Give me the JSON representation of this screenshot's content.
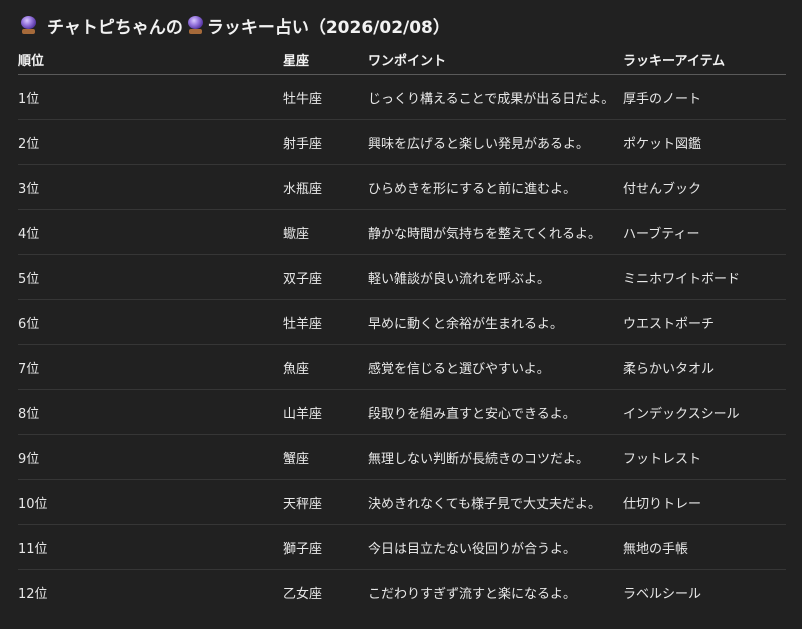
{
  "page": {
    "title": "チャトピちゃんの ラッキー占い（2026/02/08）",
    "title_prefix": "チャトピちゃんの",
    "title_suffix": "ラッキー占い（2026/02/08）",
    "title_icon": "crystal-ball-icon"
  },
  "table": {
    "headers": {
      "rank": "順位",
      "sign": "星座",
      "tip": "ワンポイント",
      "item": "ラッキーアイテム"
    },
    "rows": [
      {
        "rank": "1位",
        "sign": "牡牛座",
        "tip": "じっくり構えることで成果が出る日だよ。",
        "item": "厚手のノート"
      },
      {
        "rank": "2位",
        "sign": "射手座",
        "tip": "興味を広げると楽しい発見があるよ。",
        "item": "ポケット図鑑"
      },
      {
        "rank": "3位",
        "sign": "水瓶座",
        "tip": "ひらめきを形にすると前に進むよ。",
        "item": "付せんブック"
      },
      {
        "rank": "4位",
        "sign": "蠍座",
        "tip": "静かな時間が気持ちを整えてくれるよ。",
        "item": "ハーブティー"
      },
      {
        "rank": "5位",
        "sign": "双子座",
        "tip": "軽い雑談が良い流れを呼ぶよ。",
        "item": "ミニホワイトボード"
      },
      {
        "rank": "6位",
        "sign": "牡羊座",
        "tip": "早めに動くと余裕が生まれるよ。",
        "item": "ウエストポーチ"
      },
      {
        "rank": "7位",
        "sign": "魚座",
        "tip": "感覚を信じると選びやすいよ。",
        "item": "柔らかいタオル"
      },
      {
        "rank": "8位",
        "sign": "山羊座",
        "tip": "段取りを組み直すと安心できるよ。",
        "item": "インデックスシール"
      },
      {
        "rank": "9位",
        "sign": "蟹座",
        "tip": "無理しない判断が長続きのコツだよ。",
        "item": "フットレスト"
      },
      {
        "rank": "10位",
        "sign": "天秤座",
        "tip": "決めきれなくても様子見で大丈夫だよ。",
        "item": "仕切りトレー"
      },
      {
        "rank": "11位",
        "sign": "獅子座",
        "tip": "今日は目立たない役回りが合うよ。",
        "item": "無地の手帳"
      },
      {
        "rank": "12位",
        "sign": "乙女座",
        "tip": "こだわりすぎず流すと楽になるよ。",
        "item": "ラベルシール"
      }
    ]
  }
}
